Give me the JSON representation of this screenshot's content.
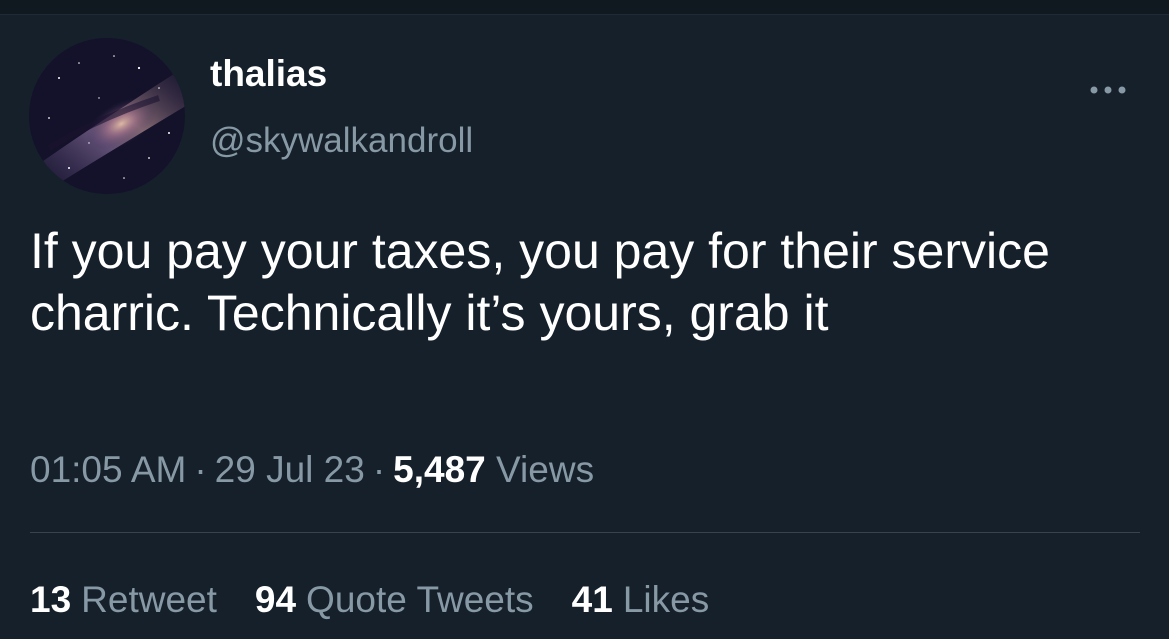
{
  "colors": {
    "background": "#15202b",
    "primary_text": "#ffffff",
    "secondary_text": "#8899a6",
    "divider": "#38444d"
  },
  "user": {
    "display_name": "thalias",
    "handle": "@skywalkandroll",
    "avatar_icon": "galaxy-avatar"
  },
  "more_icon": "more-horizontal-icon",
  "tweet": {
    "text": "If you pay your taxes, you pay for their service charric. Technically it’s yours, grab it"
  },
  "meta": {
    "time": "01:05 AM",
    "separator": "·",
    "date": "29 Jul 23",
    "views_count": "5,487",
    "views_label": "Views"
  },
  "stats": {
    "retweets_count": "13",
    "retweets_label": "Retweet",
    "quotes_count": "94",
    "quotes_label": "Quote Tweets",
    "likes_count": "41",
    "likes_label": "Likes"
  }
}
